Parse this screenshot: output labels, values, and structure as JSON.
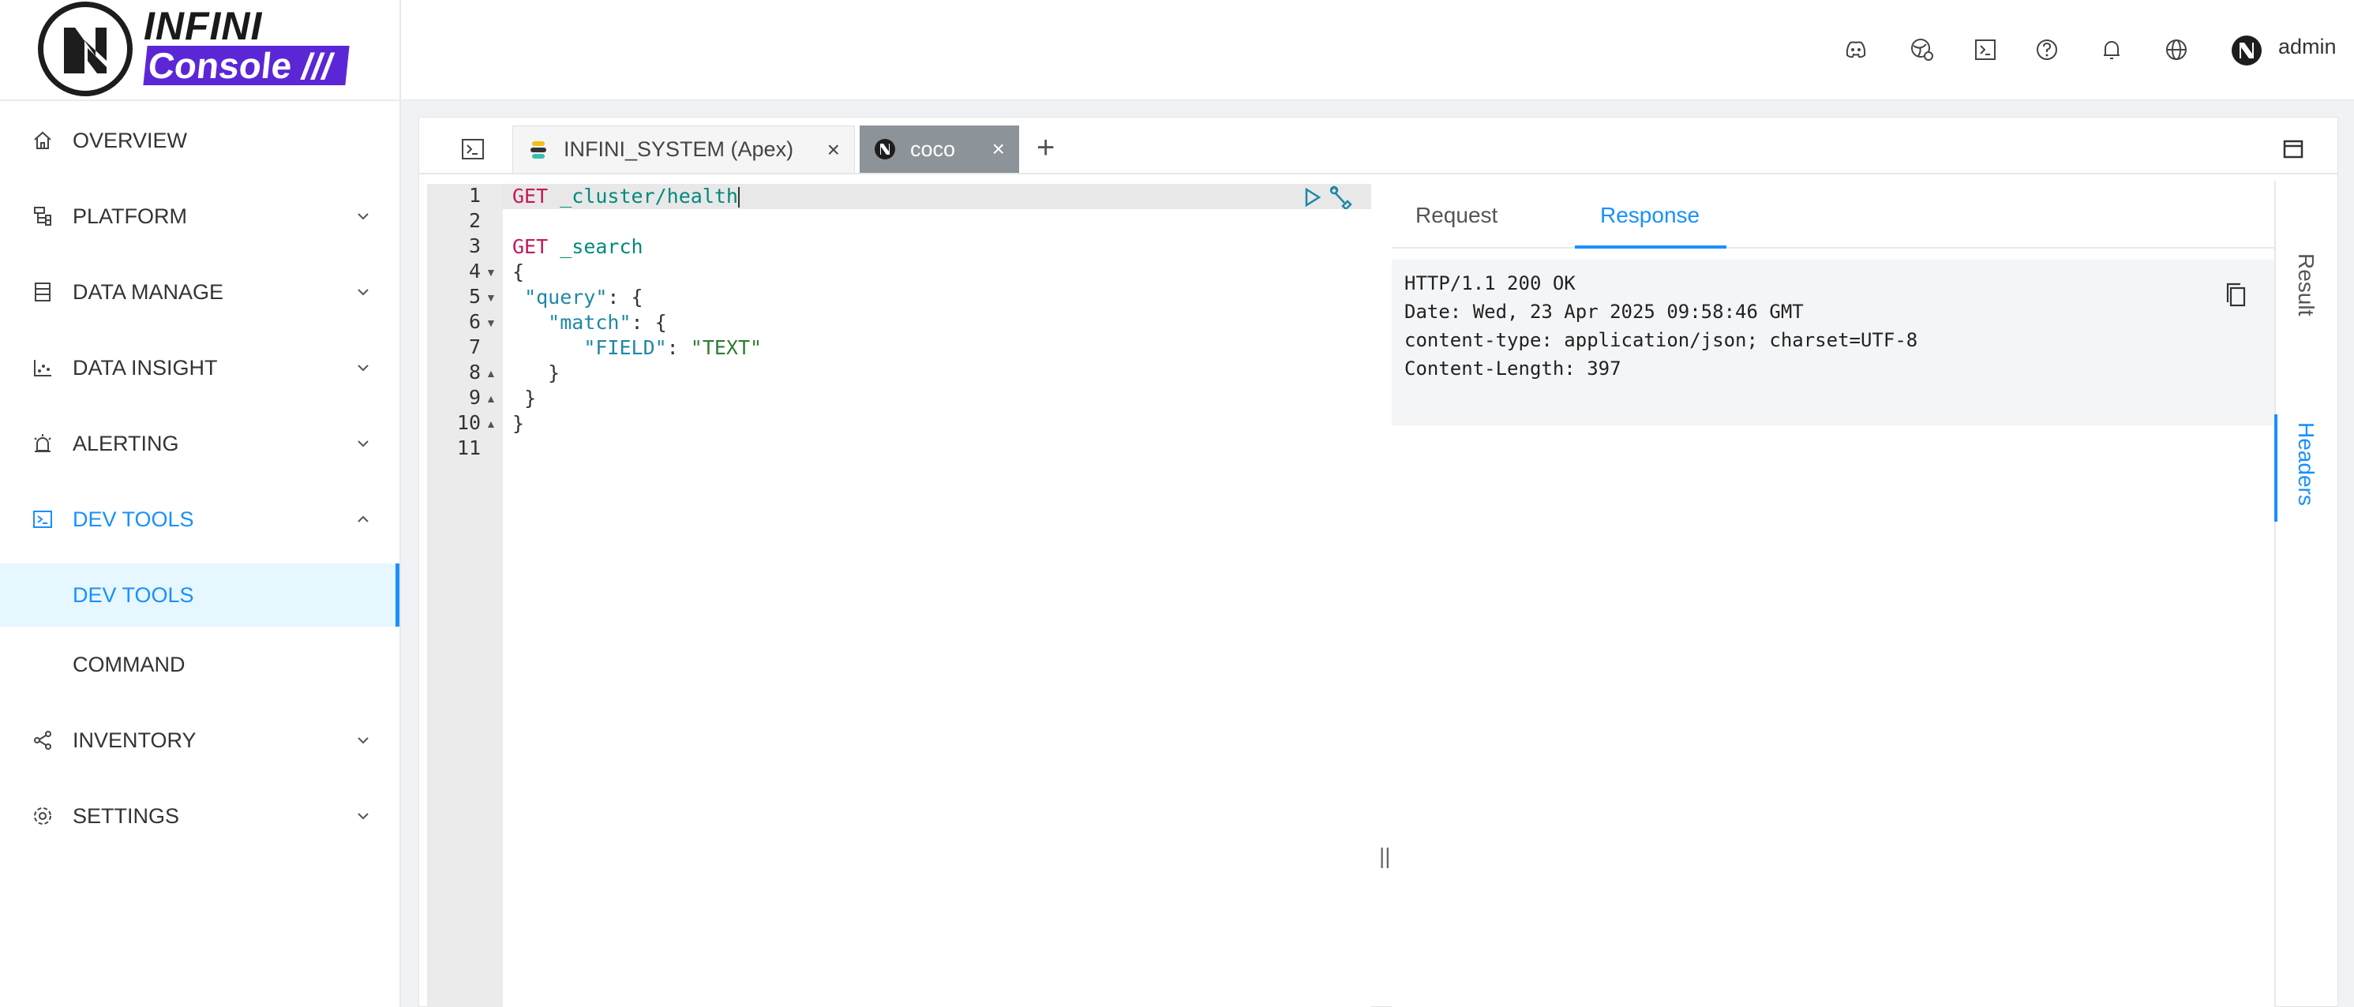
{
  "brand": {
    "line1": "INFINI",
    "line2": "Console",
    "slashes": "///"
  },
  "sidebar": {
    "items": [
      {
        "label": "OVERVIEW"
      },
      {
        "label": "PLATFORM"
      },
      {
        "label": "DATA MANAGE"
      },
      {
        "label": "DATA INSIGHT"
      },
      {
        "label": "ALERTING"
      },
      {
        "label": "DEV TOOLS"
      },
      {
        "label": "INVENTORY"
      },
      {
        "label": "SETTINGS"
      }
    ],
    "sub_items": [
      {
        "label": "DEV TOOLS"
      },
      {
        "label": "COMMAND"
      }
    ]
  },
  "header": {
    "user": "admin"
  },
  "tabs": [
    {
      "label": "INFINI_SYSTEM (Apex)"
    },
    {
      "label": "coco"
    }
  ],
  "editor": {
    "line_numbers": [
      "1",
      "2",
      "3",
      "4",
      "5",
      "6",
      "7",
      "8",
      "9",
      "10",
      "11"
    ],
    "lines": {
      "l1_method": "GET",
      "l1_path": "_cluster/health",
      "l3_method": "GET",
      "l3_path": "_search",
      "l4": "{",
      "l5_key": "\"query\"",
      "l5_rest": ": {",
      "l6_key": "\"match\"",
      "l6_rest": ": {",
      "l7_key": "\"FIELD\"",
      "l7_sep": ": ",
      "l7_val": "\"TEXT\"",
      "l8": "}",
      "l9": "}",
      "l10": "}"
    }
  },
  "response": {
    "tabs": {
      "request": "Request",
      "response": "Response"
    },
    "headers": [
      "HTTP/1.1 200 OK",
      "Date: Wed, 23 Apr 2025 09:58:46 GMT",
      "content-type: application/json; charset=UTF-8",
      "Content-Length: 397"
    ],
    "side_tabs": {
      "result": "Result",
      "headers": "Headers"
    }
  },
  "colors": {
    "accent": "#1890ff",
    "brand": "#5b27d6",
    "tab_active_bg": "#8c9399"
  }
}
